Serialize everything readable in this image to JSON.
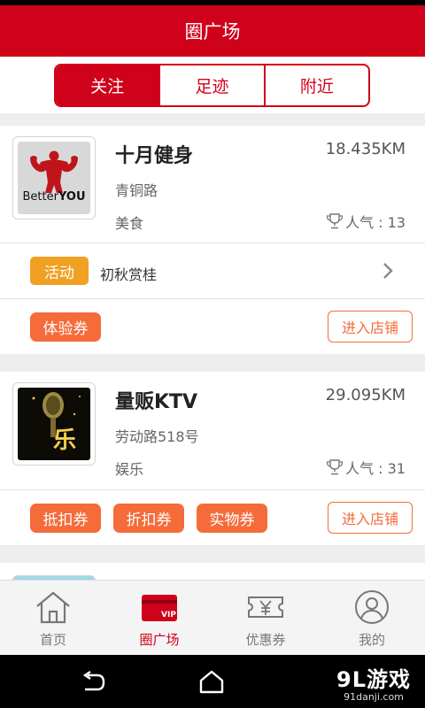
{
  "header": {
    "title": "圈广场"
  },
  "tabs": [
    {
      "label": "关注",
      "active": true
    },
    {
      "label": "足迹",
      "active": false
    },
    {
      "label": "附近",
      "active": false
    }
  ],
  "shops": [
    {
      "logo_text_a": "Better",
      "logo_text_b": "YOU",
      "name": "十月健身",
      "distance": "18.435KM",
      "street": "青铜路",
      "category": "美食",
      "popularity": "人气 : 13",
      "activity_badge": "活动",
      "activity_text": "初秋赏桂",
      "coupons": [
        "体验券"
      ],
      "enter_label": "进入店铺"
    },
    {
      "logo_text": "乐",
      "name": "量贩KTV",
      "distance": "29.095KM",
      "street": "劳动路518号",
      "category": "娱乐",
      "popularity": "人气 : 31",
      "coupons": [
        "抵扣券",
        "折扣券",
        "实物券"
      ],
      "enter_label": "进入店铺"
    }
  ],
  "bottom_tabs": [
    {
      "label": "首页",
      "icon": "home-icon",
      "active": false
    },
    {
      "label": "圈广场",
      "icon": "vip-card-icon",
      "active": true
    },
    {
      "label": "优惠券",
      "icon": "coupon-icon",
      "active": false
    },
    {
      "label": "我的",
      "icon": "profile-icon",
      "active": false
    }
  ],
  "watermark": {
    "main": "9L游戏",
    "sub": "91danji.com"
  },
  "colors": {
    "brand_red": "#d0021b",
    "coupon_orange": "#f56b3a",
    "activity_orange": "#f0a023"
  }
}
